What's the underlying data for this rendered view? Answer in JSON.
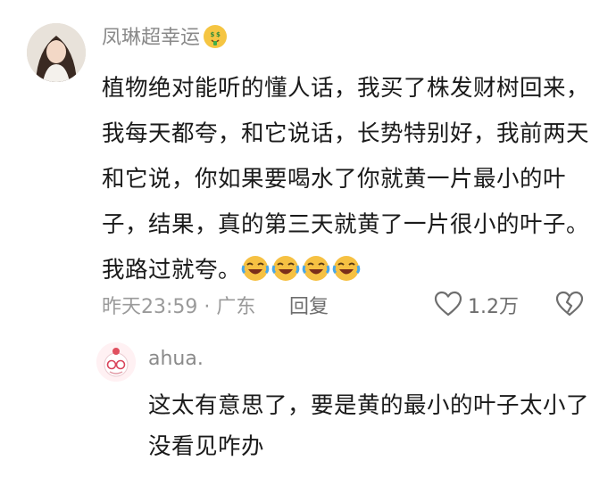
{
  "comment": {
    "username": "凤琳超幸运",
    "username_emoji": "money-face-emoji",
    "text": "植物绝对能听的懂人话，我买了株发财树回来，我每天都夸，和它说话，长势特别好，我前两天和它说，你如果要喝水了你就黄一片最小的叶子，结果，真的第三天就黄了一片很小的叶子。我路过就夸。",
    "emojis": [
      "laughing-crying-emoji",
      "laughing-crying-emoji",
      "laughing-crying-emoji",
      "laughing-crying-emoji"
    ],
    "time": "昨天23:59",
    "separator": "·",
    "location": "广东",
    "reply_label": "回复",
    "like_count": "1.2万",
    "like_icon": "heart-outline-icon",
    "dislike_icon": "broken-heart-icon"
  },
  "reply": {
    "username": "ahua.",
    "text": "这太有意思了，要是黄的最小的叶子太小了没看见咋办"
  },
  "colors": {
    "username_gray": "#8a8a8a",
    "meta_gray": "#9a9a9a",
    "text_black": "#1a1a1a",
    "emoji_yellow": "#f5c542"
  }
}
